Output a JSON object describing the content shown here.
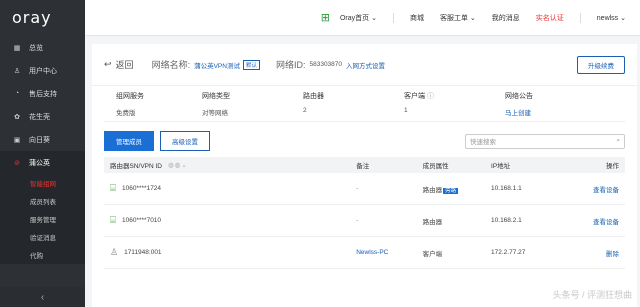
{
  "app": {
    "logo": "oray"
  },
  "sidebar": {
    "items": [
      {
        "label": "总览",
        "icon": "grid-icon"
      },
      {
        "label": "用户中心",
        "icon": "user-icon"
      },
      {
        "label": "售后支持",
        "icon": "support-icon"
      },
      {
        "label": "花生壳",
        "icon": "peanut-icon"
      },
      {
        "label": "向日葵",
        "icon": "sunflower-icon"
      },
      {
        "label": "蒲公英",
        "icon": "dandelion-icon"
      }
    ],
    "sub_items": [
      {
        "label": "智能组网"
      },
      {
        "label": "成员列表"
      },
      {
        "label": "服务管理"
      },
      {
        "label": "验证消息"
      },
      {
        "label": "代购"
      }
    ],
    "collapse_icon": "‹"
  },
  "topbar": {
    "home": "Oray首页",
    "mall": "商城",
    "ticket": "客服工单",
    "messages": "我的消息",
    "verify": "实名认证",
    "user": "newlss"
  },
  "network": {
    "back_label": "返回",
    "name_label": "网络名称:",
    "name_value": "蒲公英VPN测试",
    "name_tag": "默认",
    "id_label": "网络ID:",
    "id_value": "583303870",
    "join_link": "入网方式设置",
    "upgrade_label": "升级续费"
  },
  "info": {
    "cols": [
      {
        "key": "组网服务",
        "value": "免费版"
      },
      {
        "key": "网络类型",
        "value": "对等网络"
      },
      {
        "key": "路由器",
        "value": "2"
      },
      {
        "key": "客户端",
        "value": "1"
      },
      {
        "key": "网络公告",
        "value": "马上创建"
      }
    ]
  },
  "tabs": [
    {
      "label": "管理成员"
    },
    {
      "label": "高级设置"
    }
  ],
  "search": {
    "placeholder": "快速搜索"
  },
  "table": {
    "headers": [
      "路由器SN/VPN ID",
      "备注",
      "成员属性",
      "IP地址",
      "操作"
    ],
    "rows": [
      {
        "id": "1060****1724",
        "note": "-",
        "type": "路由器",
        "badge": "旁路",
        "ip": "10.168.1.1",
        "action": "查看设备",
        "icon": "router-icon"
      },
      {
        "id": "1060****7010",
        "note": "-",
        "type": "路由器",
        "badge": "",
        "ip": "10.168.2.1",
        "action": "查看设备",
        "icon": "router-icon"
      },
      {
        "id": "1711948:001",
        "note": "Newlss-PC",
        "type": "客户端",
        "badge": "",
        "ip": "172.2.77.27",
        "action": "删除",
        "icon": "user-icon"
      }
    ]
  },
  "watermark": "头条号 / 评测狂想曲"
}
